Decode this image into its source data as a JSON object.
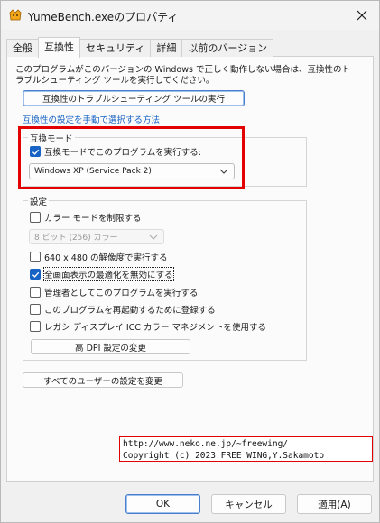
{
  "window": {
    "title": "YumeBench.exeのプロパティ",
    "close_icon": "close-icon",
    "app_icon": "app-icon"
  },
  "tabs": [
    {
      "label": "全般",
      "active": false
    },
    {
      "label": "互換性",
      "active": true
    },
    {
      "label": "セキュリティ",
      "active": false
    },
    {
      "label": "詳細",
      "active": false
    },
    {
      "label": "以前のバージョン",
      "active": false
    }
  ],
  "intro": {
    "text": "このプログラムがこのバージョンの Windows で正しく動作しない場合は、互換性のトラブルシューティング ツールを実行してください。",
    "troubleshoot_button": "互換性のトラブルシューティング ツールの実行",
    "manual_link": "互換性の設定を手動で選択する方法"
  },
  "compat_mode": {
    "group_title": "互換モード",
    "checkbox_label": "互換モードでこのプログラムを実行する:",
    "checked": true,
    "selected_os": "Windows XP (Service Pack 2)"
  },
  "settings": {
    "group_title": "設定",
    "reduced_color": {
      "label": "カラー モードを制限する",
      "checked": false
    },
    "color_select": {
      "value": "8 ビット (256) カラー",
      "disabled": true
    },
    "res_640": {
      "label": "640 x 480 の解像度で実行する",
      "checked": false
    },
    "disable_fullscreen_opt": {
      "label": "全画面表示の最適化を無効にする",
      "checked": true
    },
    "run_as_admin": {
      "label": "管理者としてこのプログラムを実行する",
      "checked": false
    },
    "register_restart": {
      "label": "このプログラムを再起動するために登録する",
      "checked": false
    },
    "legacy_icc": {
      "label": "レガシ ディスプレイ ICC カラー マネジメントを使用する",
      "checked": false
    },
    "high_dpi_button": "高 DPI 設定の変更"
  },
  "all_users_button": "すべてのユーザーの設定を変更",
  "credit": {
    "line1": "http://www.neko.ne.jp/~freewing/",
    "line2": "Copyright (c) 2023 FREE WING,Y.Sakamoto"
  },
  "footer": {
    "ok": "OK",
    "cancel": "キャンセル",
    "apply": "適用(A)"
  },
  "colors": {
    "accent": "#1762c5",
    "link": "#1461c4",
    "highlight_red": "#e30000"
  }
}
